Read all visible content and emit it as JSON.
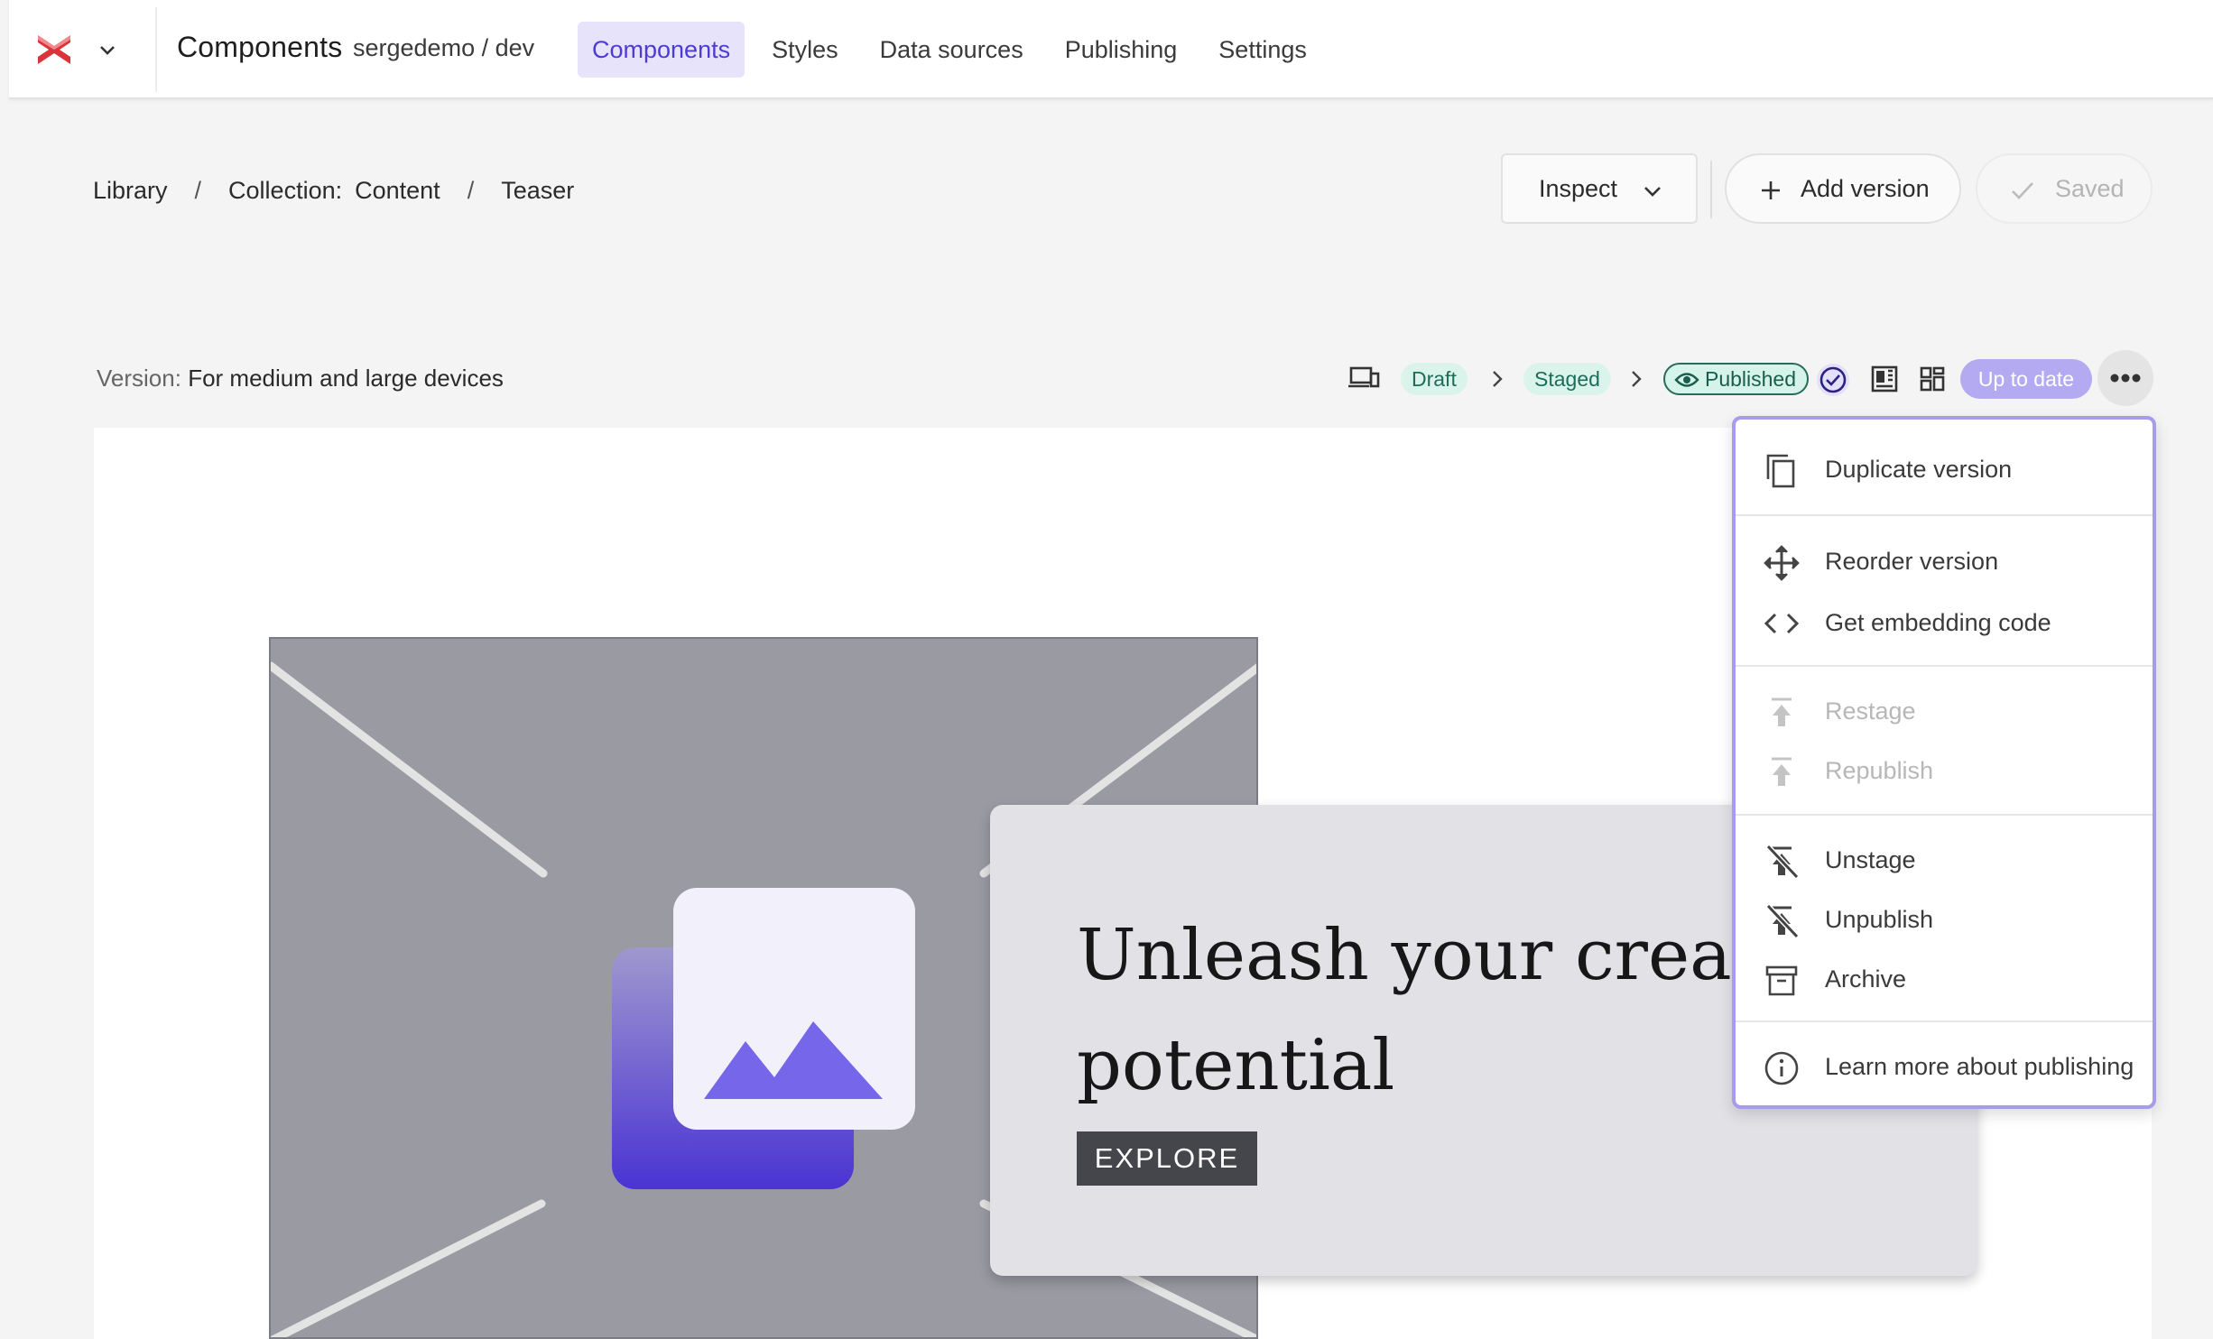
{
  "topnav": {
    "title": "Components",
    "workspace": "sergedemo / dev",
    "tabs": [
      "Components",
      "Styles",
      "Data sources",
      "Publishing",
      "Settings"
    ],
    "active_tab": "Components"
  },
  "breadcrumb": {
    "library": "Library",
    "separator": "/",
    "collection_key": "Collection:",
    "collection_value": "Content",
    "current": "Teaser"
  },
  "actions": {
    "inspect": "Inspect",
    "add_version": "Add version",
    "saved": "Saved"
  },
  "version": {
    "key": "Version:",
    "value": "For medium and large devices",
    "stages": [
      "Draft",
      "Staged",
      "Published"
    ],
    "up_to_date": "Up to date"
  },
  "preview": {
    "headline": "Unleash your creative potential",
    "cta": "EXPLORE"
  },
  "menu": {
    "items": [
      {
        "label": "Duplicate version",
        "icon": "copy-icon",
        "enabled": true
      },
      {
        "label": "Reorder version",
        "icon": "move-icon",
        "enabled": true
      },
      {
        "label": "Get embedding code",
        "icon": "code-icon",
        "enabled": true
      },
      {
        "label": "Restage",
        "icon": "upload-icon",
        "enabled": false
      },
      {
        "label": "Republish",
        "icon": "upload-icon",
        "enabled": false
      },
      {
        "label": "Unstage",
        "icon": "unpublish-icon",
        "enabled": true
      },
      {
        "label": "Unpublish",
        "icon": "unpublish-icon",
        "enabled": true
      },
      {
        "label": "Archive",
        "icon": "archive-icon",
        "enabled": true
      },
      {
        "label": "Learn more about publishing",
        "icon": "info-icon",
        "enabled": true
      }
    ]
  },
  "colors": {
    "accent": "#4d3bd6",
    "accent_bg": "#e6e3fb",
    "menu_border": "#a69bec",
    "status_green": "#daf4ec",
    "up_to_date": "#b4aaf1"
  }
}
